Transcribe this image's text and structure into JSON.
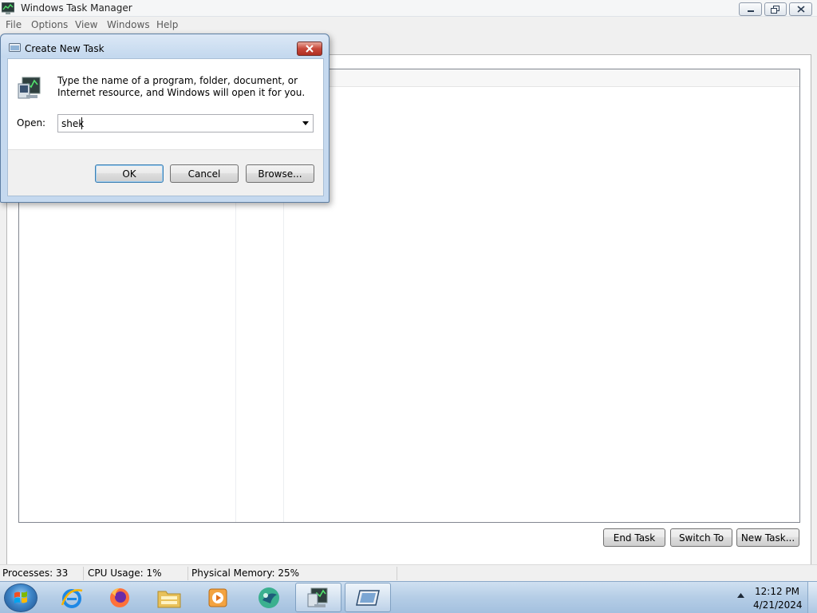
{
  "window": {
    "title": "Windows Task Manager",
    "menu": [
      "File",
      "Options",
      "View",
      "Windows",
      "Help"
    ]
  },
  "buttons": {
    "end_task": "End Task",
    "switch_to": "Switch To",
    "new_task": "New Task..."
  },
  "status": {
    "processes": "Processes: 33",
    "cpu": "CPU Usage: 1%",
    "memory": "Physical Memory: 25%"
  },
  "dialog": {
    "title": "Create New Task",
    "description": "Type the name of a program, folder, document, or Internet resource, and Windows will open it for you.",
    "open_label": "Open:",
    "open_value": "shek",
    "ok": "OK",
    "cancel": "Cancel",
    "browse": "Browse..."
  },
  "taskbar": {
    "items": [
      "start-orb",
      "internet-explorer-icon",
      "firefox-icon",
      "file-explorer-icon",
      "media-player-icon",
      "app-icon",
      "task-manager-icon",
      "remote-desktop-icon"
    ],
    "time": "12:12 PM",
    "date": "4/21/2024"
  },
  "colors": {
    "accent": "#3c7fb1",
    "dialog_frame": "#c5d9ef",
    "close_red": "#c7483a"
  }
}
